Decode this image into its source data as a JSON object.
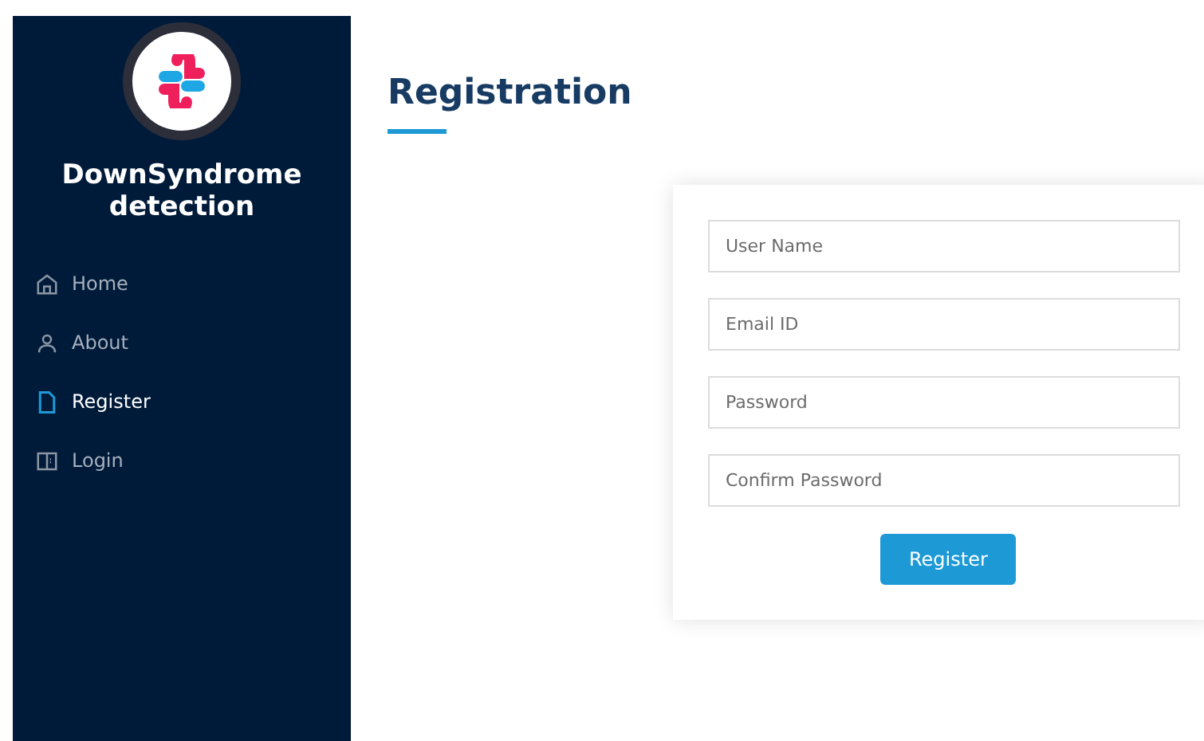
{
  "sidebar": {
    "brand": "DownSyndrome detection",
    "items": [
      {
        "label": "Home",
        "selected": false
      },
      {
        "label": "About",
        "selected": false
      },
      {
        "label": "Register",
        "selected": true
      },
      {
        "label": "Login",
        "selected": false
      }
    ]
  },
  "page": {
    "title": "Registration"
  },
  "form": {
    "fields": [
      {
        "placeholder": "User Name"
      },
      {
        "placeholder": "Email ID"
      },
      {
        "placeholder": "Password"
      },
      {
        "placeholder": "Confirm Password"
      }
    ],
    "submit": "Register"
  }
}
